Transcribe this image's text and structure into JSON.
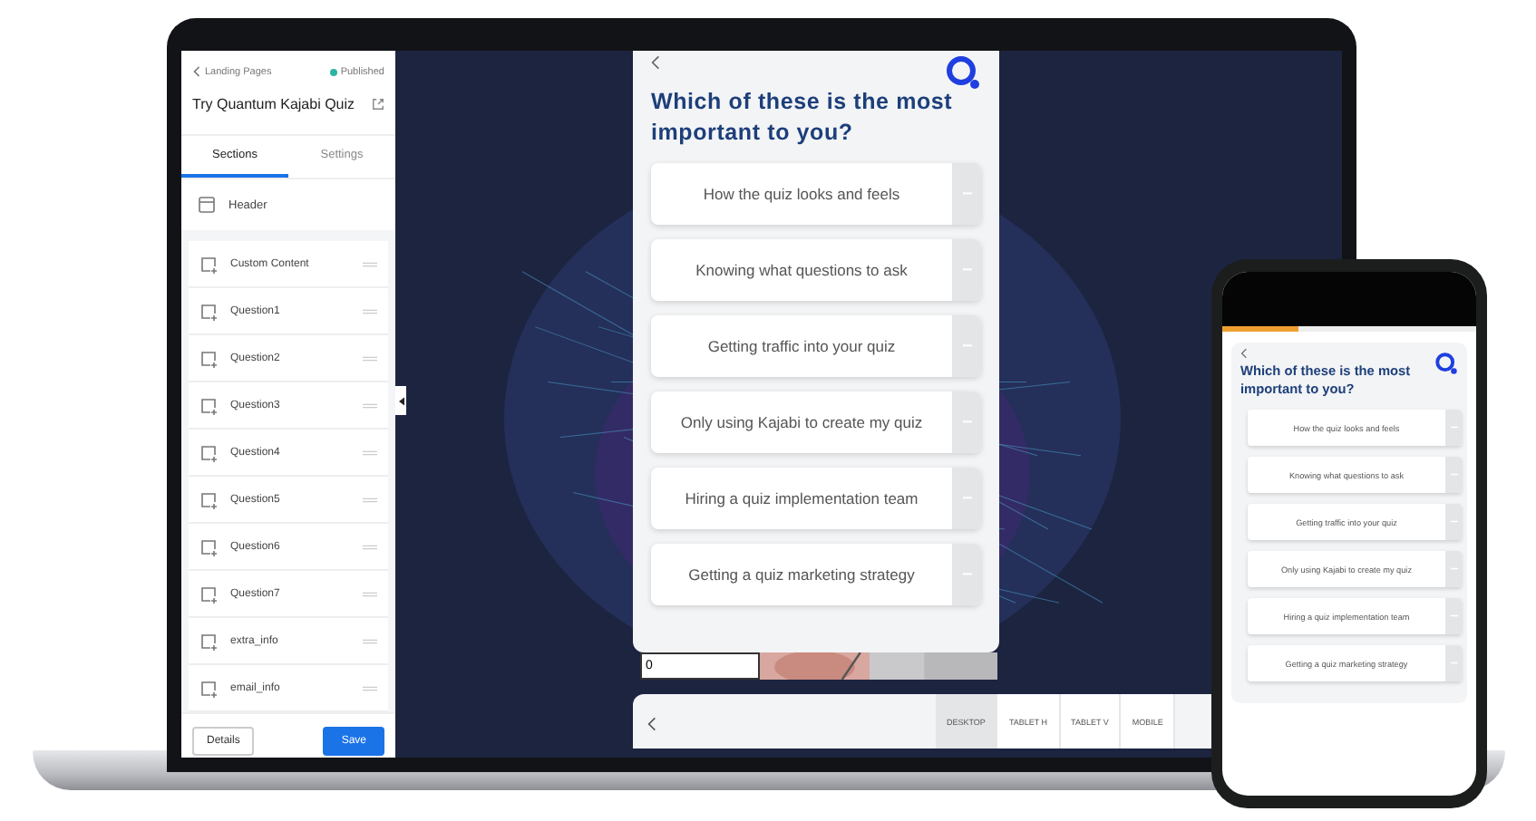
{
  "sidebar": {
    "back_link": "Landing Pages",
    "status": "Published",
    "title": "Try Quantum Kajabi Quiz",
    "tabs": [
      {
        "label": "Sections",
        "selected": true
      },
      {
        "label": "Settings",
        "selected": false
      }
    ],
    "header_item": "Header",
    "sections": [
      "Custom Content",
      "Question1",
      "Question2",
      "Question3",
      "Question4",
      "Question5",
      "Question6",
      "Question7",
      "extra_info",
      "email_info"
    ],
    "buttons": [
      {
        "label": "Details",
        "kind": "secondary"
      },
      {
        "label": "Save",
        "kind": "primary"
      }
    ]
  },
  "preview": {
    "question": "Which of these is the most important to you?",
    "options": [
      "How the quiz looks and feels",
      "Knowing what questions to ask",
      "Getting traffic into your quiz",
      "Only using Kajabi to create my quiz",
      "Hiring a quiz implementation team",
      "Getting a quiz marketing strategy"
    ],
    "input_value": "0"
  },
  "device_bar": {
    "tabs": [
      {
        "label": "DESKTOP",
        "selected": true
      },
      {
        "label": "TABLET H",
        "selected": false
      },
      {
        "label": "TABLET V",
        "selected": false
      },
      {
        "label": "MOBILE",
        "selected": false
      }
    ]
  },
  "phone": {
    "progress": {
      "level": 0.3
    },
    "question": "Which of these is the most important to you?",
    "options": [
      "How the quiz looks and feels",
      "Knowing what questions to ask",
      "Getting traffic into your quiz",
      "Only using Kajabi to create my quiz",
      "Hiring a quiz implementation team",
      "Getting a quiz marketing strategy"
    ]
  }
}
